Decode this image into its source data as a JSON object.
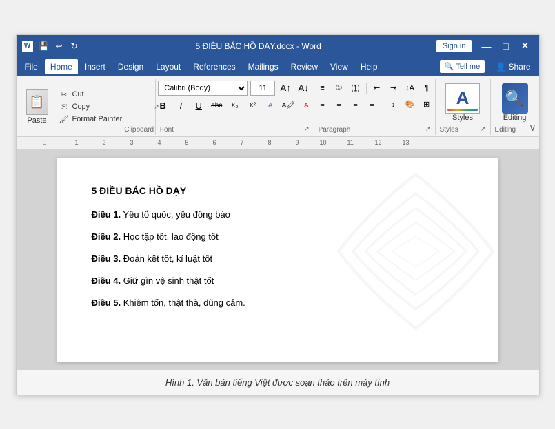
{
  "titlebar": {
    "filename": "5 ĐIỀU BÁC HỒ DẠY.docx",
    "app": "Word",
    "title_full": "5 ĐIỀU BÁC HỒ DẠY.docx - Word",
    "signin": "Sign in",
    "minimize": "—",
    "maximize": "□",
    "close": "✕"
  },
  "menubar": {
    "items": [
      "File",
      "Home",
      "Insert",
      "Design",
      "Layout",
      "References",
      "Mailings",
      "Review",
      "View",
      "Help"
    ],
    "active": "Home",
    "tell_me": "Tell me",
    "share": "Share"
  },
  "ribbon": {
    "clipboard": {
      "label": "Clipboard",
      "paste_label": "Paste",
      "cut": "Cut",
      "copy": "Copy",
      "format_painter": "Format Painter"
    },
    "font": {
      "label": "Font",
      "name": "Calibri (Body)",
      "size": "11",
      "bold": "B",
      "italic": "I",
      "underline": "U",
      "strikethrough": "abc",
      "subscript": "X₂",
      "superscript": "X²"
    },
    "paragraph": {
      "label": "Paragraph"
    },
    "styles": {
      "label": "Styles",
      "btn_label": "Styles"
    },
    "editing": {
      "label": "Editing",
      "btn_label": "Editing"
    }
  },
  "document": {
    "title": "5 ĐIỀU BÁC HỒ DẠY",
    "lines": [
      {
        "bold_part": "Điều 1.",
        "normal_part": " Yêu tổ quốc, yêu đồng bào"
      },
      {
        "bold_part": "Điều 2.",
        "normal_part": " Học tập tốt, lao động tốt"
      },
      {
        "bold_part": "Điều 3.",
        "normal_part": " Đoàn kết tốt, kỉ luật tốt"
      },
      {
        "bold_part": "Điều 4.",
        "normal_part": " Giữ gìn vệ sinh thật tốt"
      },
      {
        "bold_part": "Điều 5. ",
        "normal_part": " Khiêm tốn, thật thà, dũng cảm."
      }
    ]
  },
  "caption": "Hình 1. Văn bản tiếng Việt được soạn thảo trên máy tính"
}
